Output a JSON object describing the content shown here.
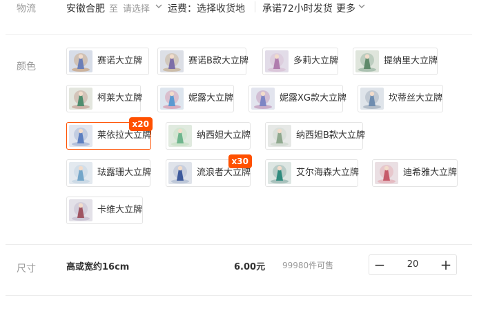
{
  "shipping": {
    "label": "物流",
    "origin": "安徽合肥",
    "to_word": "至",
    "destination_placeholder": "请选择",
    "fee_text": "运费：选择收货地",
    "promise": "承诺72小时发货",
    "more": "更多"
  },
  "color": {
    "label": "颜色",
    "options": [
      {
        "label": "赛诺大立牌",
        "selected": false,
        "badge": ""
      },
      {
        "label": "赛诺B款大立牌",
        "selected": false,
        "badge": ""
      },
      {
        "label": "多莉大立牌",
        "selected": false,
        "badge": ""
      },
      {
        "label": "提纳里大立牌",
        "selected": false,
        "badge": ""
      },
      {
        "label": "柯莱大立牌",
        "selected": false,
        "badge": ""
      },
      {
        "label": "妮露大立牌",
        "selected": false,
        "badge": ""
      },
      {
        "label": "妮露XG款大立牌",
        "selected": false,
        "badge": ""
      },
      {
        "label": "坎蒂丝大立牌",
        "selected": false,
        "badge": ""
      },
      {
        "label": "莱依拉大立牌",
        "selected": true,
        "badge": "x20"
      },
      {
        "label": "纳西妲大立牌",
        "selected": false,
        "badge": ""
      },
      {
        "label": "纳西妲B款大立牌",
        "selected": false,
        "badge": ""
      },
      {
        "label": "珐露珊大立牌",
        "selected": false,
        "badge": ""
      },
      {
        "label": "流浪者大立牌",
        "selected": false,
        "badge": "x30"
      },
      {
        "label": "艾尔海森大立牌",
        "selected": false,
        "badge": ""
      },
      {
        "label": "迪希雅大立牌",
        "selected": false,
        "badge": ""
      },
      {
        "label": "卡维大立牌",
        "selected": false,
        "badge": ""
      }
    ]
  },
  "size": {
    "label": "尺寸",
    "name": "高或宽约16cm",
    "price": "6.00元",
    "stock": "99980件可售",
    "quantity": "20",
    "minus": "−",
    "plus": "+"
  },
  "colors": {
    "accent": "#ff5000",
    "border": "#e4e4e4",
    "muted": "#999999"
  }
}
